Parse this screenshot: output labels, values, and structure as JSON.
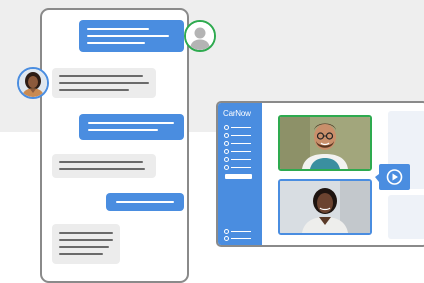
{
  "app": {
    "brand": "CarNow"
  },
  "colors": {
    "accent_blue": "#4a8de0",
    "active_green": "#2eaa4f",
    "incoming_bubble": "#ececec",
    "window_border": "#8a8a8a"
  },
  "chat": {
    "messages": [
      {
        "direction": "outgoing",
        "avatar": "user-avatar"
      },
      {
        "direction": "incoming",
        "avatar": "agent-avatar"
      },
      {
        "direction": "outgoing"
      },
      {
        "direction": "incoming"
      },
      {
        "direction": "outgoing"
      },
      {
        "direction": "incoming"
      }
    ]
  },
  "video_call": {
    "participants": [
      {
        "name_icon": "man-with-glasses-video",
        "active": true
      },
      {
        "name_icon": "woman-video",
        "active": false
      }
    ],
    "action_icon": "play-icon"
  }
}
